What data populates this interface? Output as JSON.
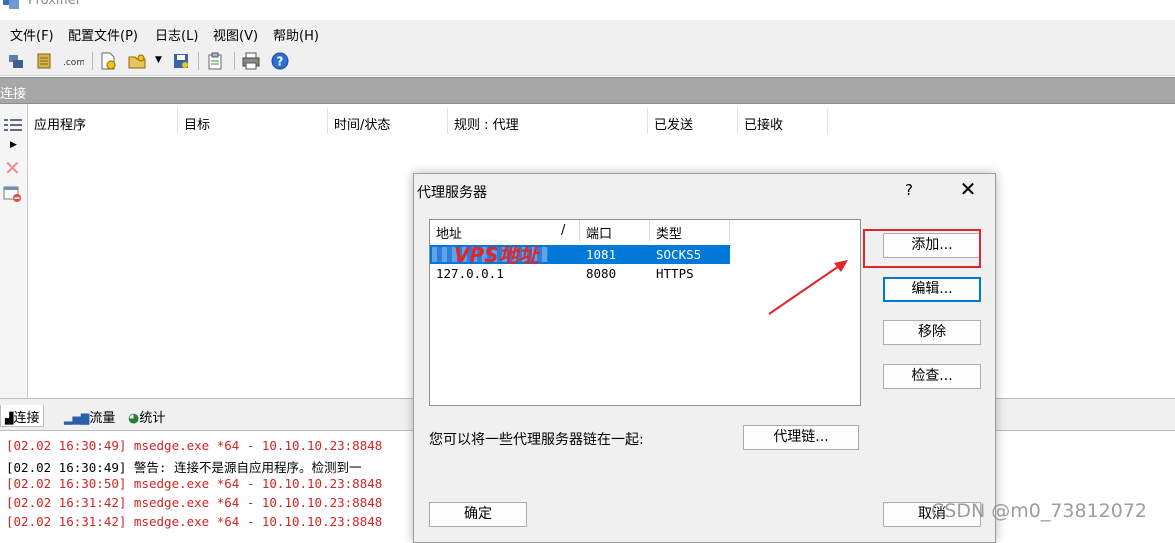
{
  "app": {
    "title": "Proxifier"
  },
  "menu": [
    "文件(F)",
    "配置文件(P)",
    "日志(L)",
    "视图(V)",
    "帮助(H)"
  ],
  "toolbar": {
    "icons": [
      "network-icon",
      "profile-icon",
      "dns-icon",
      "new-icon",
      "open-icon",
      "save-icon",
      "clipboard-icon",
      "print-icon",
      "help-icon"
    ]
  },
  "section": {
    "label": "连接"
  },
  "connections": {
    "columns": [
      "应用程序",
      "目标",
      "时间/状态",
      "规则 : 代理",
      "已发送",
      "已接收"
    ]
  },
  "bottom_tabs": [
    {
      "label": "连接"
    },
    {
      "label": "流量"
    },
    {
      "label": "统计"
    }
  ],
  "log": [
    {
      "text": "[02.02 16:30:49] msedge.exe *64 - 10.10.10.23:8848",
      "color": "#d32424"
    },
    {
      "text": "[02.02 16:30:49] 警告: 连接不是源自应用程序。检测到一",
      "color": "#000000"
    },
    {
      "text": "[02.02 16:30:50] msedge.exe *64 - 10.10.10.23:8848",
      "color": "#d32424"
    },
    {
      "text": "[02.02 16:31:42] msedge.exe *64 - 10.10.10.23:8848",
      "color": "#d32424"
    },
    {
      "text": "[02.02 16:31:42] msedge.exe *64 - 10.10.10.23:8848",
      "color": "#d32424"
    }
  ],
  "dialog": {
    "title": "代理服务器",
    "help": "?",
    "close": "✕",
    "list": {
      "columns": [
        "地址",
        "/",
        "端口",
        "类型"
      ],
      "rows": [
        {
          "address": "",
          "port": "1081",
          "type": "SOCKS5",
          "selected": true
        },
        {
          "address": "127.0.0.1",
          "port": "8080",
          "type": "HTTPS",
          "selected": false
        }
      ]
    },
    "buttons": {
      "add": "添加...",
      "edit": "编辑...",
      "remove": "移除",
      "check": "检查...",
      "chain": "代理链...",
      "ok": "确定",
      "cancel": "取消"
    },
    "chain_text": "您可以将一些代理服务器链在一起:",
    "annotation": "VPS地址"
  },
  "watermark": "CSDN @m0_73812072",
  "colors": {
    "selection": "#0078d7",
    "annotation": "#e0262a",
    "log_red": "#d32424",
    "section_bar": "#a7a7a7"
  }
}
